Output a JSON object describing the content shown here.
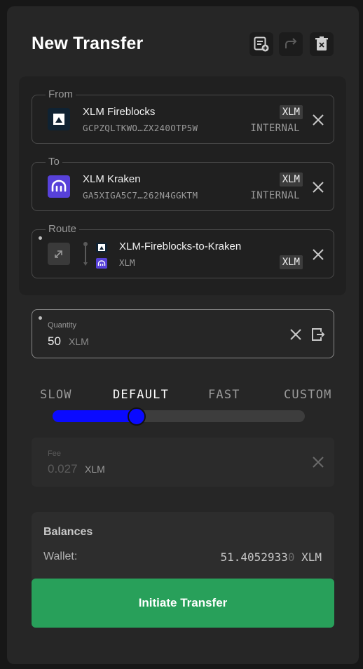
{
  "header": {
    "title": "New Transfer",
    "actions": [
      {
        "icon": "add-list-icon"
      },
      {
        "icon": "redo-icon"
      },
      {
        "icon": "delete-icon"
      }
    ]
  },
  "from": {
    "legend": "From",
    "name": "XLM Fireblocks",
    "address": "GCPZQLTKWO…ZX240OTP5W",
    "asset": "XLM",
    "type": "INTERNAL",
    "logo_icon": "fireblocks-logo"
  },
  "to": {
    "legend": "To",
    "name": "XLM Kraken",
    "address": "GA5XIGA5C7…262N4GGKTM",
    "asset": "XLM",
    "type": "INTERNAL",
    "logo_icon": "kraken-logo"
  },
  "route": {
    "legend": "Route",
    "name": "XLM-Fireblocks-to-Kraken",
    "asset_small": "XLM",
    "asset": "XLM"
  },
  "quantity": {
    "label": "Quantity",
    "value": "50",
    "unit": "XLM"
  },
  "speed": {
    "options": [
      "SLOW",
      "DEFAULT",
      "FAST",
      "CUSTOM"
    ],
    "selected": "DEFAULT",
    "slider_fraction": 0.333
  },
  "fee": {
    "label": "Fee",
    "value": "0.027",
    "unit": "XLM"
  },
  "balances": {
    "title": "Balances",
    "wallet_label": "Wallet:",
    "wallet_value": "51.4052933",
    "wallet_value_faded": "0",
    "wallet_unit": "XLM"
  },
  "cta": {
    "label": "Initiate Transfer"
  },
  "colors": {
    "accent_blue": "#0a0aff",
    "cta_green": "#28a05a",
    "kraken_purple": "#5741d9"
  }
}
